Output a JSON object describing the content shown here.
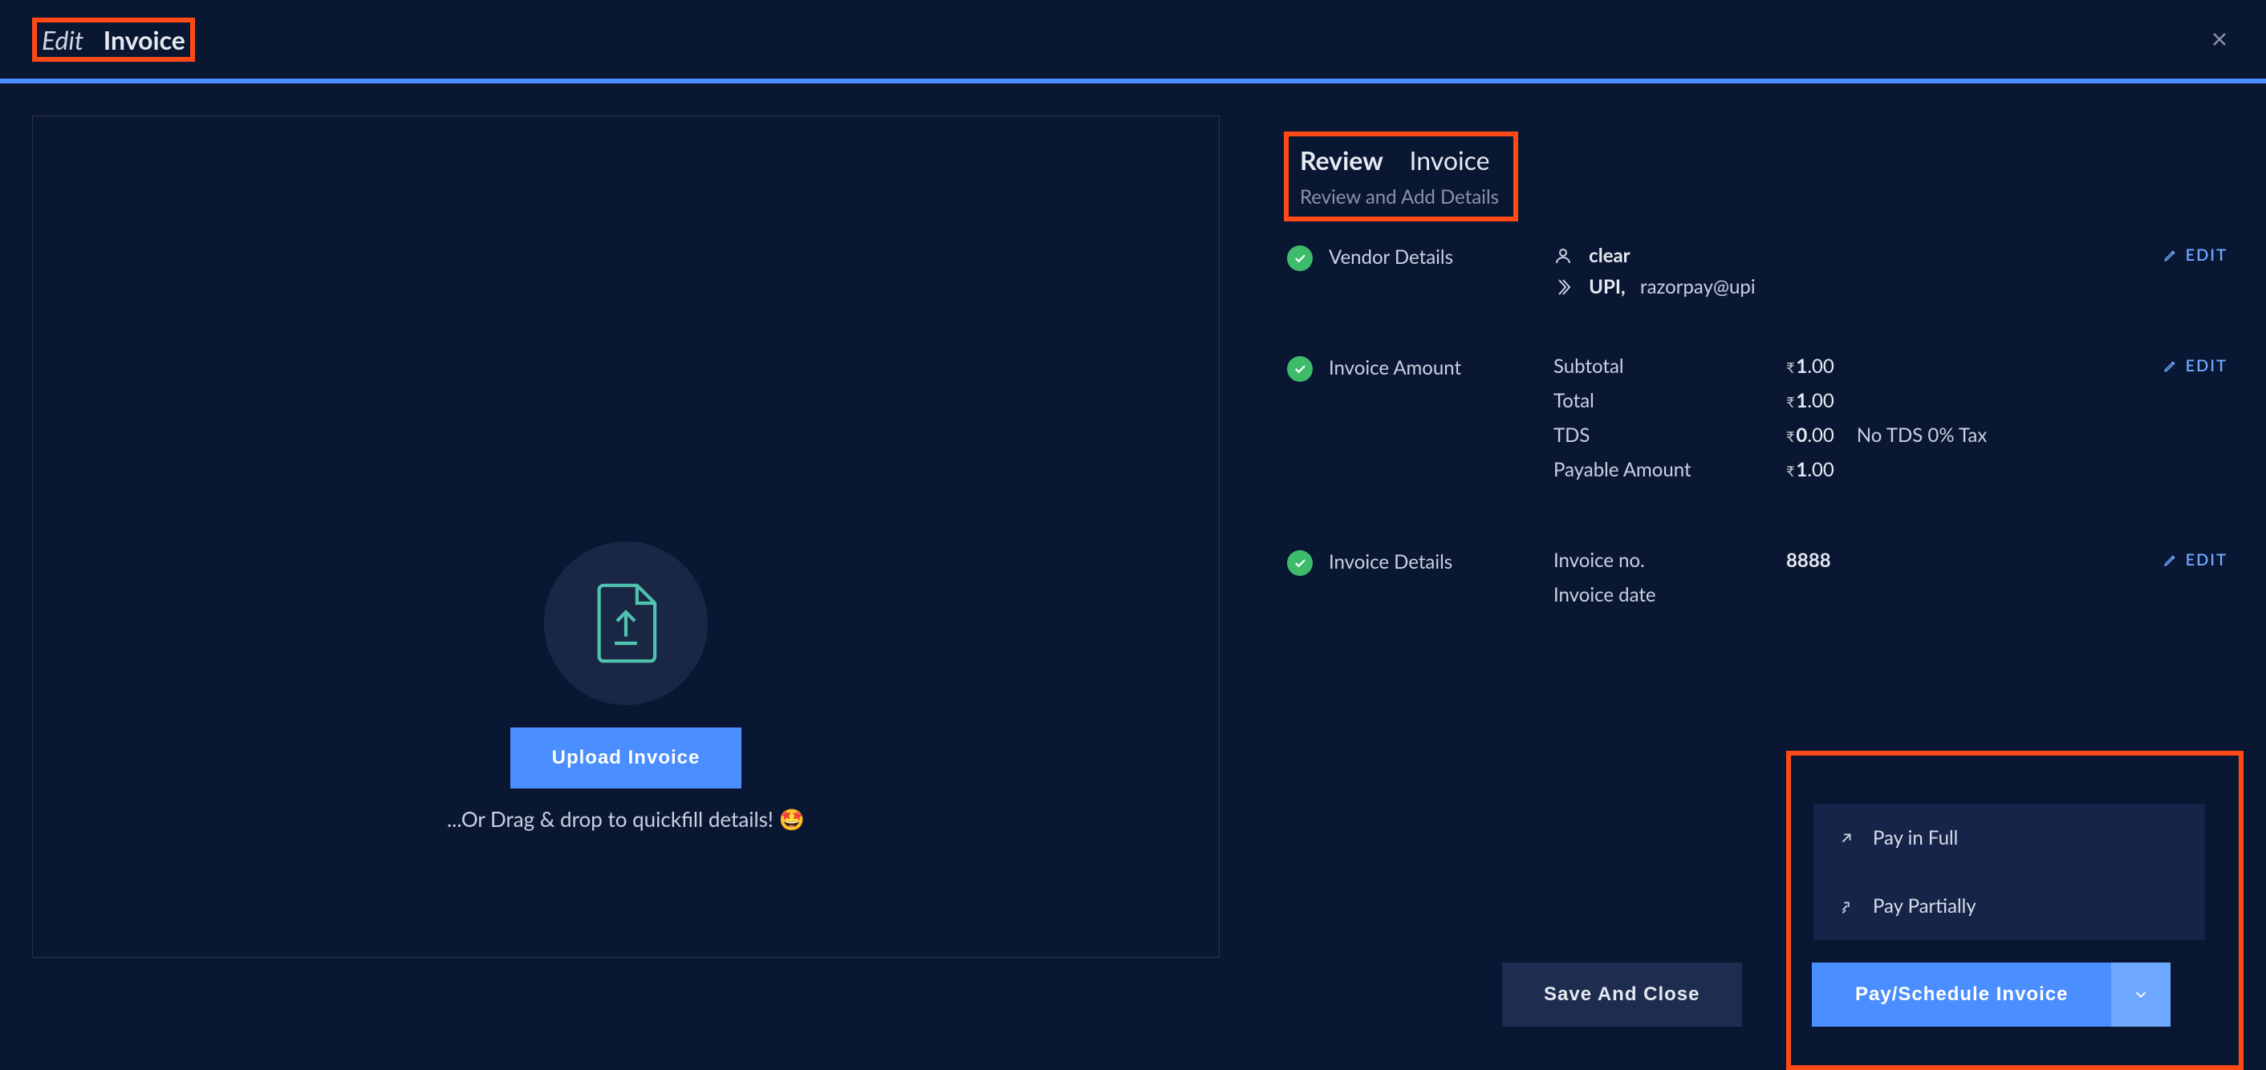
{
  "header": {
    "title_prefix": "Edit",
    "title_main": "Invoice"
  },
  "upload": {
    "button_label": "Upload Invoice",
    "drag_text": "...Or Drag & drop to quickfill details! 🤩"
  },
  "review": {
    "title_bold": "Review",
    "title_rest": "Invoice",
    "subtitle": "Review and Add Details"
  },
  "vendor": {
    "section_label": "Vendor Details",
    "name": "clear",
    "pay_method": "UPI,",
    "upi_id": "razorpay@upi",
    "edit_label": "EDIT"
  },
  "amount": {
    "section_label": "Invoice Amount",
    "edit_label": "EDIT",
    "subtotal_label": "Subtotal",
    "subtotal_value_int": "1",
    "subtotal_value_dec": ".00",
    "total_label": "Total",
    "total_value_int": "1",
    "total_value_dec": ".00",
    "tds_label": "TDS",
    "tds_value_int": "0",
    "tds_value_dec": ".00",
    "tds_note": "No TDS 0% Tax",
    "payable_label": "Payable Amount",
    "payable_value_int": "1",
    "payable_value_dec": ".00"
  },
  "details": {
    "section_label": "Invoice Details",
    "edit_label": "EDIT",
    "inv_no_label": "Invoice no.",
    "inv_no_value": "8888",
    "inv_date_label": "Invoice date"
  },
  "dropdown": {
    "pay_full": "Pay in Full",
    "pay_partial": "Pay Partially"
  },
  "footer": {
    "save_label": "Save And Close",
    "pay_label": "Pay/Schedule Invoice"
  },
  "currency_symbol": "₹"
}
